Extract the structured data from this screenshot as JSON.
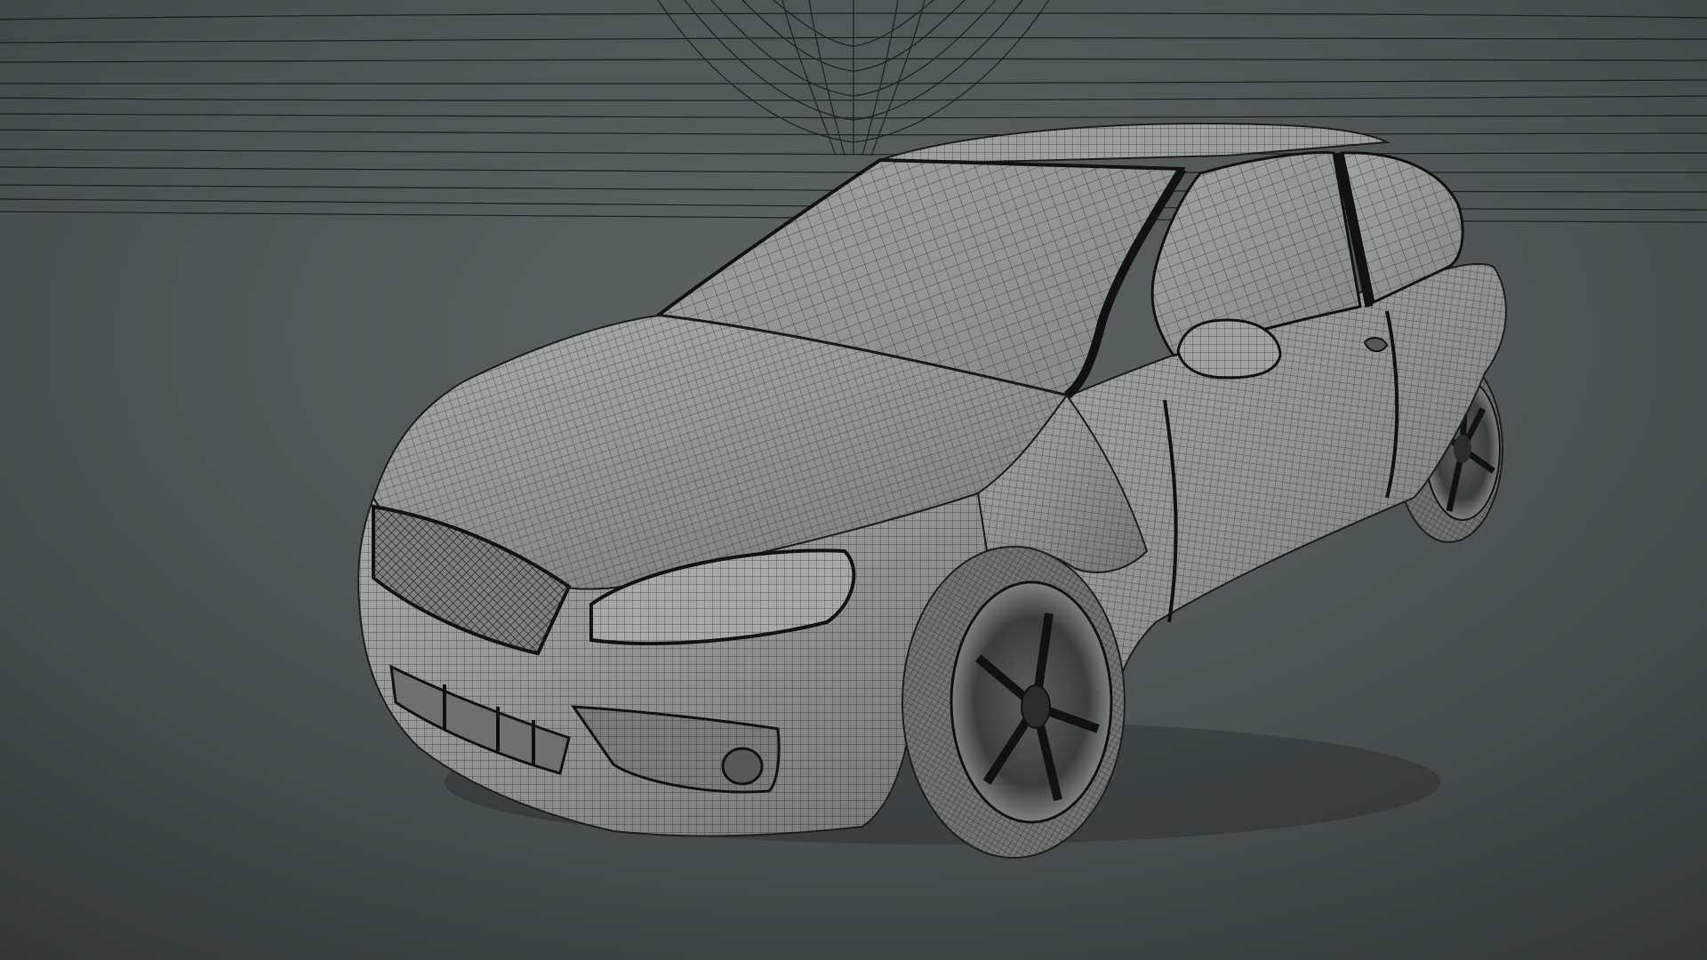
{
  "viewport": {
    "mode": "3d-viewport",
    "display_mode": "wireframe-on-shaded",
    "subject": "hatchback-car-mesh",
    "background_top_color": "#5c6461",
    "background_bottom_color": "#2f3433",
    "mesh_fill_color": "#8d918f",
    "wire_color": "#1b1d1c",
    "environment_wire_color": "#1a1c1c"
  }
}
